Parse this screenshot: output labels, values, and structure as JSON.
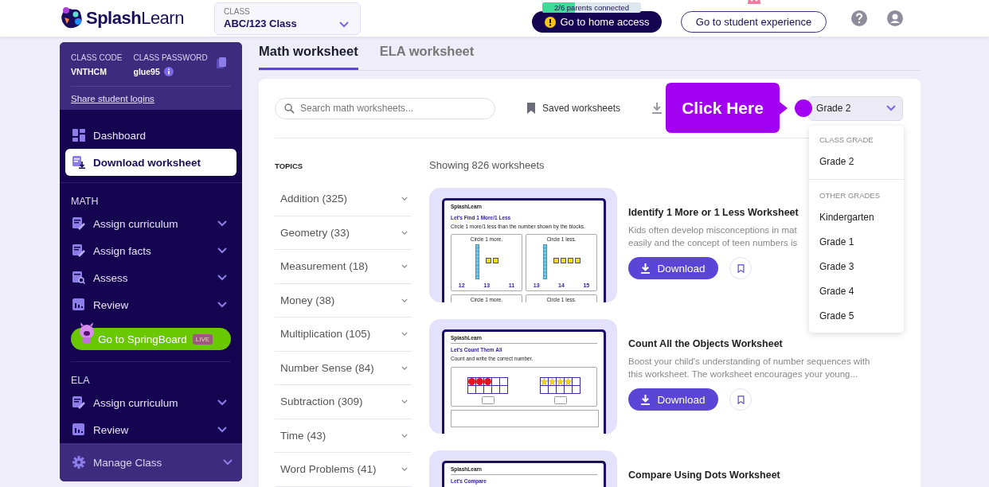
{
  "header": {
    "logo": "**Splash**Learn",
    "class_picker": {
      "label": "CLASS",
      "value": "ABC/123 Class"
    },
    "parents": {
      "text": "2/6 parents connected",
      "level": 0.33
    },
    "home_button": "Go to home access",
    "student_button": "Go to student experience"
  },
  "sidebar": {
    "class_code": {
      "label": "CLASS CODE",
      "value": "VNTHCM"
    },
    "class_password": {
      "label": "CLASS PASSWORD",
      "value": "glue95"
    },
    "share_link": "Share student logins",
    "top_items": [
      {
        "label": "Dashboard",
        "kind": "grid",
        "selected": false
      },
      {
        "label": "Download worksheet",
        "kind": "download",
        "selected": true
      }
    ],
    "sections": [
      {
        "title": "MATH",
        "items": [
          {
            "label": "Assign curriculum",
            "kind": "edit",
            "expanded": false
          },
          {
            "label": "Assign facts",
            "kind": "edit",
            "expanded": false
          },
          {
            "label": "Assess",
            "kind": "assess",
            "expanded": false
          },
          {
            "label": "Review",
            "kind": "chart",
            "expanded": false
          }
        ],
        "promo": {
          "label": "Go to SpringBoard",
          "badge": "LIVE"
        }
      },
      {
        "title": "ELA",
        "items": [
          {
            "label": "Assign curriculum",
            "kind": "edit",
            "expanded": false
          },
          {
            "label": "Review",
            "kind": "chart",
            "expanded": false
          }
        ]
      }
    ],
    "footer": {
      "label": "Manage Class",
      "kind": "gear",
      "expanded": false
    }
  },
  "tabs": [
    {
      "label": "Math worksheet",
      "selected": true
    },
    {
      "label": "ELA worksheet",
      "selected": false
    }
  ],
  "toolbar": {
    "search": {
      "placeholder": "Search math worksheets..."
    },
    "saved": "Saved worksheets",
    "grade": "Grade 2"
  },
  "callout": "Click Here",
  "grade_menu": {
    "groups": [
      {
        "title": "CLASS GRADE",
        "items": [
          "Grade 2"
        ]
      },
      {
        "title": "OTHER GRADES",
        "items": [
          "Kindergarten",
          "Grade 1",
          "Grade 3",
          "Grade 4",
          "Grade 5"
        ]
      }
    ]
  },
  "topics": {
    "title": "TOPICS",
    "items": [
      "Addition (325)",
      "Geometry (33)",
      "Measurement (18)",
      "Money (38)",
      "Multiplication (105)",
      "Number Sense (84)",
      "Subtraction (309)",
      "Time (43)",
      "Word Problems (41)"
    ]
  },
  "results": {
    "count": "Showing 826 worksheets",
    "worksheets": [
      {
        "title": "Identify 1 More or 1 Less Worksheet",
        "lines": [
          "Kids often develop misconceptions in mat",
          "easily and the concept of teen numbers is"
        ],
        "download": "Download",
        "preview": {
          "kind": "blocks",
          "brand": "SplashLearn",
          "heading": "Let's Find 1 More/1 Less",
          "instruction": "Circle 1 more/1 less than the number shown by the blocks.",
          "panels": [
            {
              "label": "Circle 1 more.",
              "cubes": [
                true,
                true
              ],
              "numbers": [
                "12",
                "13",
                "11"
              ]
            },
            {
              "label": "Circle 1 less.",
              "cubes": [
                true,
                true,
                true,
                true
              ],
              "numbers": [
                "13",
                "14",
                "15"
              ]
            }
          ],
          "more_panels": [
            "Circle 1 more.",
            "Circle 1 less."
          ]
        }
      },
      {
        "title": "Count All the Objects Worksheet",
        "lines": [
          "Boost your child's understanding of number sequences with",
          "this worksheet. The worksheet encourages your young..."
        ],
        "download": "Download",
        "preview": {
          "kind": "frames",
          "brand": "SplashLearn",
          "heading": "Let's Count Them All",
          "instruction": "Count and write the correct number.",
          "frames": [
            {
              "kind": "dot",
              "cells": [
                true,
                true,
                true,
                false,
                false
              ]
            },
            {
              "kind": "star",
              "cells": [
                true,
                true,
                true,
                true,
                false
              ]
            }
          ]
        }
      },
      {
        "title": "Compare Using Dots Worksheet",
        "preview": {
          "kind": "partial",
          "brand": "SplashLearn",
          "heading": "Let's Compare"
        }
      }
    ]
  }
}
